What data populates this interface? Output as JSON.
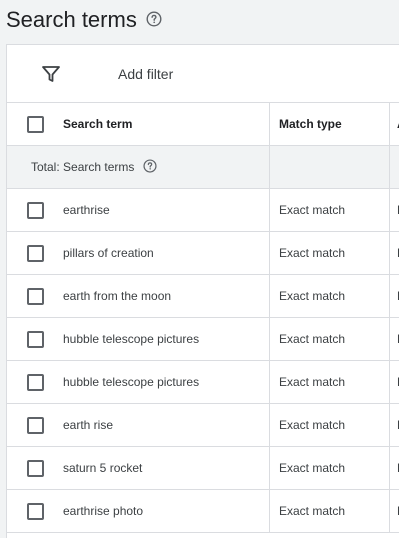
{
  "page": {
    "title": "Search terms",
    "help_icon": "help-circle-icon"
  },
  "filter_bar": {
    "icon": "filter-icon",
    "add_filter_label": "Add filter"
  },
  "table": {
    "columns": [
      "Search term",
      "Match type",
      "A"
    ],
    "total_row": {
      "label": "Total: Search terms",
      "help_icon": "help-circle-icon"
    },
    "rows": [
      {
        "term": "earthrise",
        "match_type": "Exact match",
        "third": "E"
      },
      {
        "term": "pillars of creation",
        "match_type": "Exact match",
        "third": "E"
      },
      {
        "term": "earth from the moon",
        "match_type": "Exact match",
        "third": "E"
      },
      {
        "term": "hubble telescope pictures",
        "match_type": "Exact match",
        "third": "E"
      },
      {
        "term": "hubble telescope pictures",
        "match_type": "Exact match",
        "third": "E"
      },
      {
        "term": "earth rise",
        "match_type": "Exact match",
        "third": "E"
      },
      {
        "term": "saturn 5 rocket",
        "match_type": "Exact match",
        "third": "E"
      },
      {
        "term": "earthrise photo",
        "match_type": "Exact match",
        "third": "E"
      }
    ]
  },
  "colors": {
    "background": "#f1f3f4",
    "card": "#ffffff",
    "border": "#dadce0",
    "text": "#202124",
    "checkbox": "#5f6368"
  }
}
